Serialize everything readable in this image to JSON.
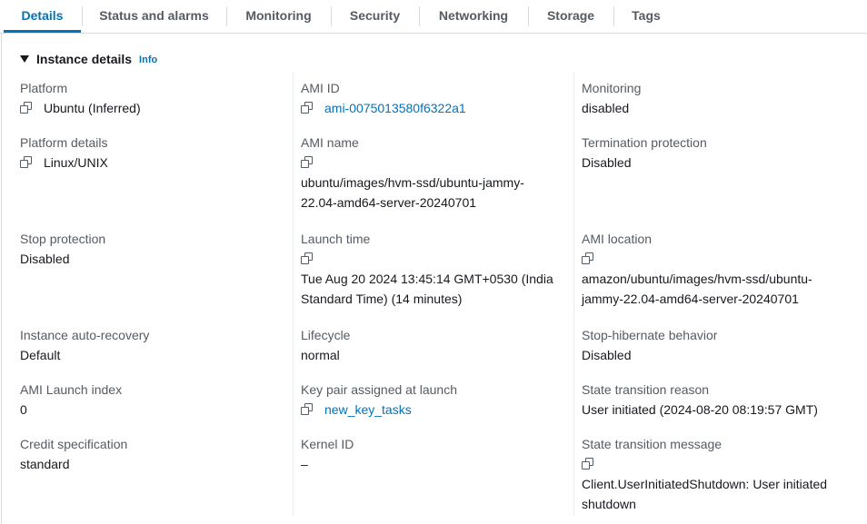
{
  "tabs": [
    "Details",
    "Status and alarms",
    "Monitoring",
    "Security",
    "Networking",
    "Storage",
    "Tags"
  ],
  "active_tab": "Details",
  "section": {
    "title": "Instance details",
    "info": "Info"
  },
  "fields": {
    "platform": {
      "label": "Platform",
      "value": "Ubuntu (Inferred)"
    },
    "platform_details": {
      "label": "Platform details",
      "value": "Linux/UNIX"
    },
    "stop_protection": {
      "label": "Stop protection",
      "value": "Disabled"
    },
    "auto_recovery": {
      "label": "Instance auto-recovery",
      "value": "Default"
    },
    "ami_launch_index": {
      "label": "AMI Launch index",
      "value": "0"
    },
    "credit_spec": {
      "label": "Credit specification",
      "value": "standard"
    },
    "ami_id": {
      "label": "AMI ID",
      "value": "ami-0075013580f6322a1"
    },
    "ami_name": {
      "label": "AMI name",
      "value_line1": "ubuntu/images/hvm-ssd/ubuntu-jammy-",
      "value_line2": "22.04-amd64-server-20240701"
    },
    "launch_time": {
      "label": "Launch time",
      "value_line1": "Tue Aug 20 2024 13:45:14 GMT+0530 (India",
      "value_line2": "Standard Time) (14 minutes)"
    },
    "lifecycle": {
      "label": "Lifecycle",
      "value": "normal"
    },
    "key_pair": {
      "label": "Key pair assigned at launch",
      "value": "new_key_tasks"
    },
    "kernel_id": {
      "label": "Kernel ID",
      "value": "–"
    },
    "monitoring": {
      "label": "Monitoring",
      "value": "disabled"
    },
    "termination_protection": {
      "label": "Termination protection",
      "value": "Disabled"
    },
    "ami_location": {
      "label": "AMI location",
      "value_line1": "amazon/ubuntu/images/hvm-ssd/ubuntu-",
      "value_line2": "jammy-22.04-amd64-server-20240701"
    },
    "stop_hibernate": {
      "label": "Stop-hibernate behavior",
      "value": "Disabled"
    },
    "state_transition_reason": {
      "label": "State transition reason",
      "value": "User initiated (2024-08-20 08:19:57 GMT)"
    },
    "state_transition_message": {
      "label": "State transition message",
      "value_line1": "Client.UserInitiatedShutdown: User initiated",
      "value_line2": "shutdown"
    }
  },
  "colors": {
    "link": "#0073bb",
    "label": "#545b64",
    "text": "#16191f",
    "border": "#d5dbdb"
  }
}
